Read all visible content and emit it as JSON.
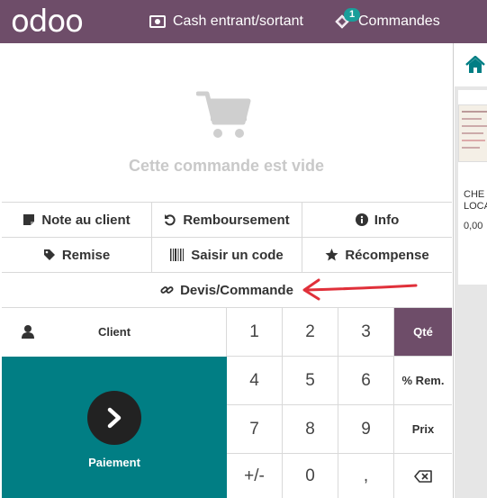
{
  "header": {
    "logo": "odoo",
    "cash_label": "Cash entrant/sortant",
    "orders_label": "Commandes",
    "orders_badge": "1"
  },
  "order": {
    "empty_message": "Cette commande est vide"
  },
  "controls": {
    "row1": [
      "Note au client",
      "Remboursement",
      "Info"
    ],
    "row2": [
      "Remise",
      "Saisir un code",
      "Récompense"
    ],
    "quote_order": "Devis/Commande"
  },
  "numpad": {
    "client": "Client",
    "payment": "Paiement",
    "keys": [
      "1",
      "2",
      "3",
      "4",
      "5",
      "6",
      "7",
      "8",
      "9",
      "+/-",
      "0",
      ","
    ],
    "modes": [
      "Qté",
      "% Rem.",
      "Prix"
    ],
    "active_mode": "Qté"
  },
  "products": [
    {
      "name_line1": "CHE",
      "name_line2": "LOCA",
      "price": "0,00"
    }
  ],
  "colors": {
    "brand": "#6e4d69",
    "payment": "#017e84",
    "badge": "#1a9e9a",
    "annotation_arrow": "#e0303a"
  }
}
